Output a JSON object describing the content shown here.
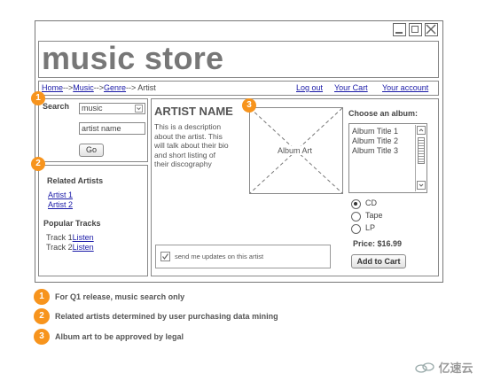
{
  "app": {
    "title": "music store"
  },
  "breadcrumb": [
    "Home",
    "-->",
    "Music",
    "-->",
    "Genre",
    "--> Artist"
  ],
  "top_links": [
    "Log out",
    "Your Cart",
    "Your account"
  ],
  "search": {
    "label": "Search",
    "select_value": "music",
    "input_value": "artist name",
    "go_label": "Go"
  },
  "related": {
    "heading": "Related Artists",
    "artists": [
      "Artist 1",
      "Artist 2"
    ]
  },
  "popular": {
    "heading": "Popular Tracks",
    "tracks": [
      {
        "label": "Track 1",
        "link": "Listen"
      },
      {
        "label": "Track 2",
        "link": "Listen"
      }
    ]
  },
  "artist": {
    "name": "ARTIST NAME",
    "description_lines": [
      "This is a description",
      "about the artist.  This",
      "will talk about their bio",
      "and short listing of",
      "their discography"
    ]
  },
  "album_art": {
    "label": "Album Art"
  },
  "updates": {
    "label": "send me updates on this artist",
    "checked": true
  },
  "album_chooser": {
    "heading": "Choose an album:",
    "albums": [
      "Album Title 1",
      "Album Title 2",
      "Album Title 3"
    ]
  },
  "formats": {
    "options": [
      "CD",
      "Tape",
      "LP"
    ],
    "selected": "CD"
  },
  "price": {
    "text": "Price: $16.99"
  },
  "add_to_cart": {
    "label": "Add to Cart"
  },
  "badges": [
    "1",
    "2",
    "3"
  ],
  "notes": [
    {
      "num": "1",
      "text": "For Q1 release, music search only"
    },
    {
      "num": "2",
      "text": "Related artists determined by user purchasing data mining"
    },
    {
      "num": "3",
      "text": "Album art to be approved by legal"
    }
  ],
  "watermark": "亿速云",
  "colors": {
    "accent": "#f7941d",
    "link": "#1a1aa8",
    "border": "#888888"
  }
}
